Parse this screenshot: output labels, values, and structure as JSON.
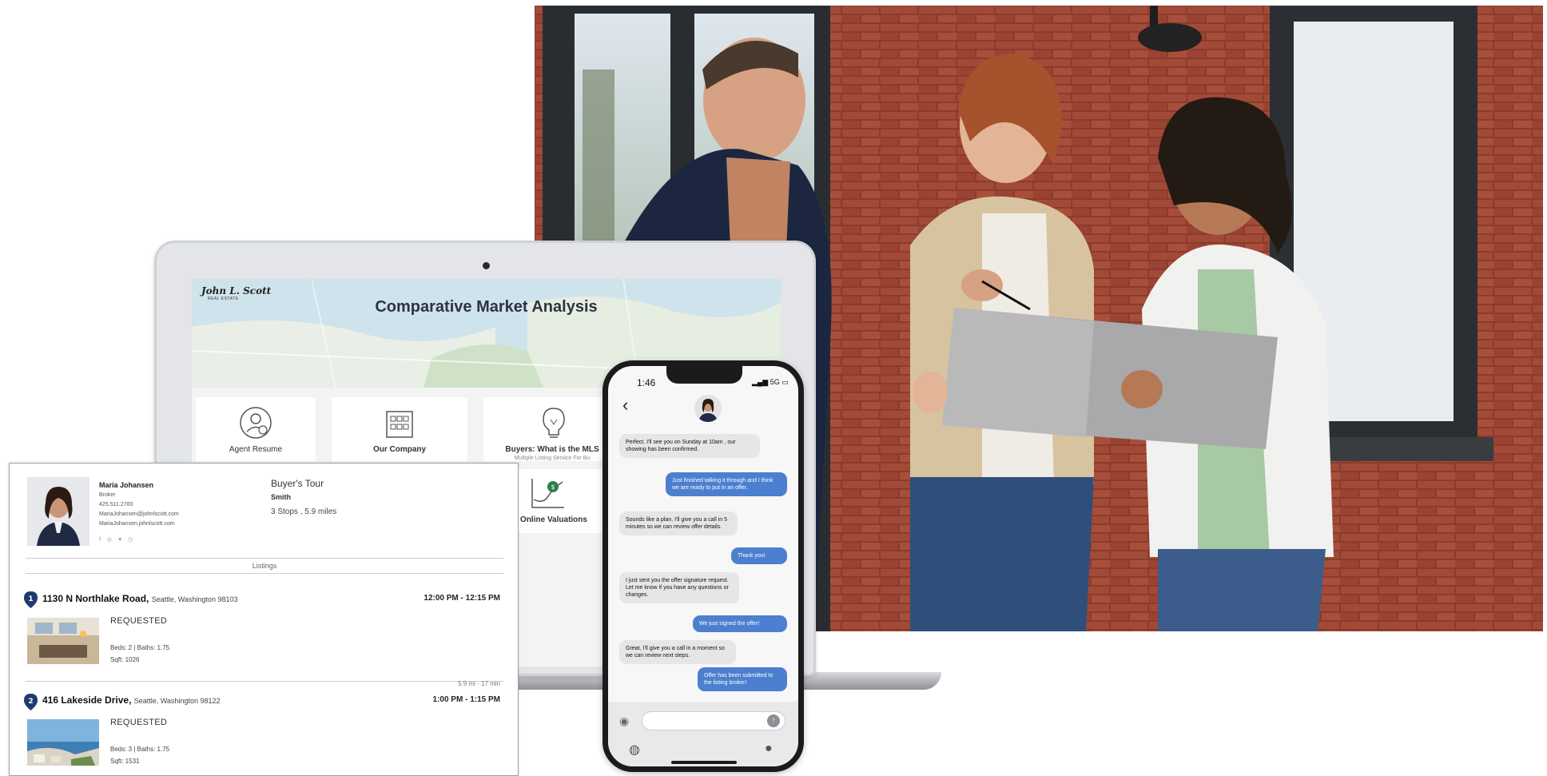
{
  "laptop": {
    "logo": "John L. Scott",
    "logo_sub": "REAL ESTATE",
    "title": "Comparative Market Analysis",
    "cards": [
      {
        "label": "Agent Resume",
        "icon": "person-icon"
      },
      {
        "label": "Our Company",
        "icon": "building-icon"
      },
      {
        "label": "Buyers: What is the MLS",
        "sub": "Multiple Listing Service For Bu",
        "icon": "lightbulb-icon"
      },
      {
        "label": "Online Valuations",
        "icon": "valuation-chart-icon"
      }
    ]
  },
  "tour": {
    "agent": {
      "name": "Maria Johansen",
      "title": "Broker",
      "phone": "425.511.2700",
      "email": "MariaJohansen@johnlscott.com",
      "website": "MariaJohansen.johnlscott.com",
      "social": "f ◎ ♥ ◷"
    },
    "title": "Buyer's Tour",
    "client": "Smith",
    "summary": "3 Stops , 5.9 miles",
    "section": "Listings",
    "stops": [
      {
        "number": "1",
        "street": "1130 N Northlake Road,",
        "city": "Seattle, Washington 98103",
        "time": "12:00 PM - 12:15 PM",
        "status": "REQUESTED",
        "beds_baths": "Beds: 2 | Baths: 1.75",
        "sqft": "Sqft: 1026"
      },
      {
        "number": "2",
        "street": "416 Lakeside Drive,",
        "city": "Seattle, Washington 98122",
        "time": "1:00 PM - 1:15 PM",
        "status": "REQUESTED",
        "beds_baths": "Beds: 3 | Baths: 1.75",
        "sqft": "Sqft: 1531",
        "drive": "5.9 mi - 17 min"
      }
    ]
  },
  "phone": {
    "time": "1:46",
    "status": "5G",
    "messages": [
      {
        "dir": "in",
        "text": "Perfect. I'll see you on Sunday at 10am , our showing has been confirmed."
      },
      {
        "dir": "out",
        "text": "Just finished talking it through and I think we are ready to put in an offer."
      },
      {
        "dir": "in",
        "text": "Sounds like a plan. I'll give you a call in 5 minutes so we can review offer details."
      },
      {
        "dir": "out",
        "text": "Thank you!"
      },
      {
        "dir": "in",
        "text": "I just sent you the offer signature request. Let me know if you have any questions or changes."
      },
      {
        "dir": "out",
        "text": "We just signed the offer!"
      },
      {
        "dir": "in",
        "text": "Great, I'll give you a call in a moment so we can review next steps."
      },
      {
        "dir": "out",
        "text": "Offer has been submitted to the listing broker!"
      }
    ]
  }
}
